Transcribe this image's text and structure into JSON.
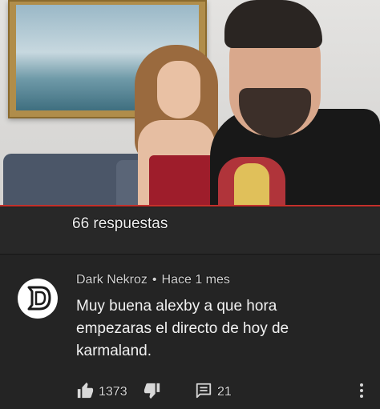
{
  "video": {
    "accent_color": "#c4302b"
  },
  "replies": {
    "count_label": "66 respuestas"
  },
  "comment": {
    "avatar_letter": "D",
    "author": "Dark Nekroz",
    "separator": "•",
    "time": "Hace 1 mes",
    "text": "Muy buena alexby a que hora empezaras el directo de hoy de karmaland.",
    "likes": "1373",
    "replies": "21"
  },
  "icons": {
    "like": "thumbs-up-icon",
    "dislike": "thumbs-down-icon",
    "reply": "comment-icon",
    "more": "more-vertical-icon"
  }
}
